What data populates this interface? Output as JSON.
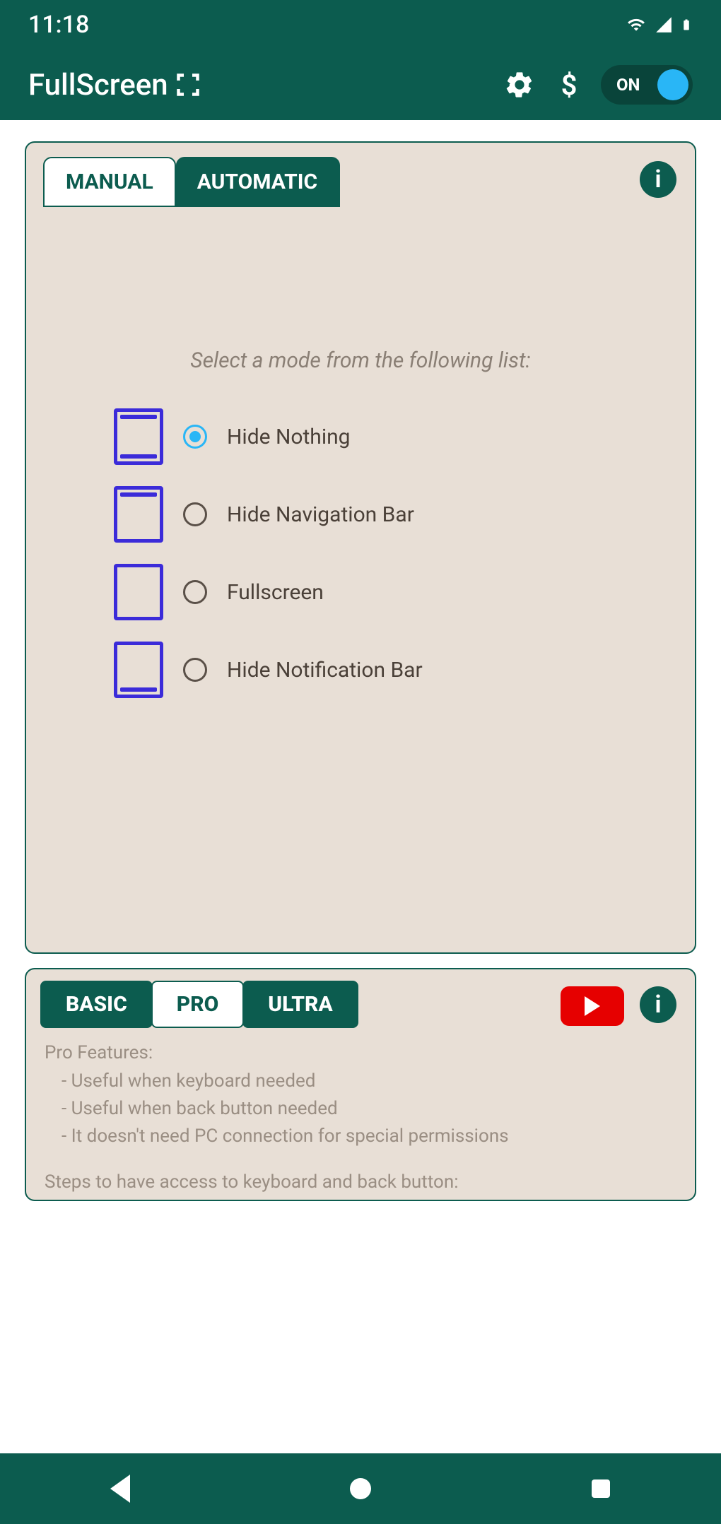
{
  "statusbar": {
    "time": "11:18"
  },
  "appbar": {
    "title": "FullScreen",
    "toggle_label": "ON"
  },
  "mode_card": {
    "tabs": {
      "manual": "MANUAL",
      "automatic": "AUTOMATIC"
    },
    "prompt": "Select a mode from the following list:",
    "options": [
      {
        "label": "Hide Nothing",
        "selected": true,
        "top": true,
        "bottom": true
      },
      {
        "label": "Hide Navigation Bar",
        "selected": false,
        "top": true,
        "bottom": false
      },
      {
        "label": "Fullscreen",
        "selected": false,
        "top": false,
        "bottom": false
      },
      {
        "label": "Hide Notification Bar",
        "selected": false,
        "top": false,
        "bottom": true
      }
    ]
  },
  "plan_card": {
    "tabs": {
      "basic": "BASIC",
      "pro": "PRO",
      "ultra": "ULTRA"
    },
    "features_title": "Pro Features:",
    "features": [
      "Useful when keyboard needed",
      "Useful when back button needed",
      "It doesn't need PC connection for special permissions"
    ],
    "steps": "Steps to have access to keyboard and back button:"
  }
}
